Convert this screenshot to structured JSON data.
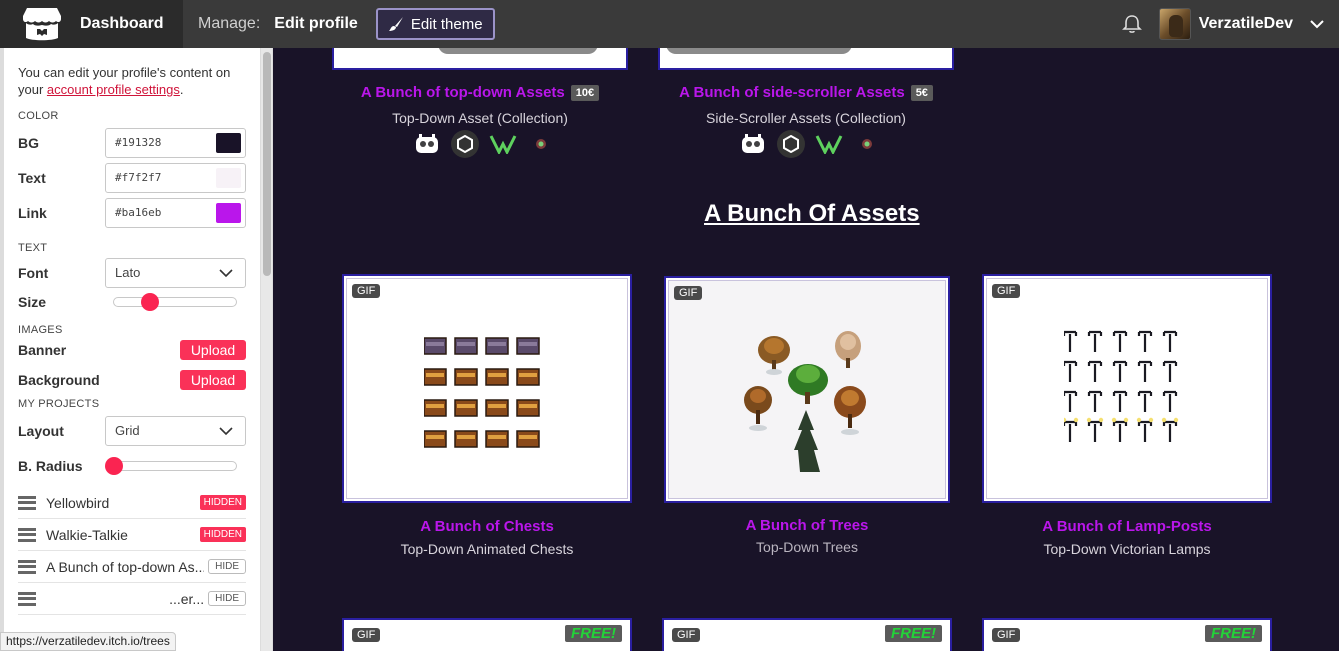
{
  "topbar": {
    "dashboard_label": "Dashboard",
    "manage_label": "Manage:",
    "edit_profile_label": "Edit profile",
    "edit_theme_label": "Edit theme",
    "username": "VerzatileDev"
  },
  "sidebar": {
    "intro_prefix": "You can edit your profile's content on your",
    "intro_link": "account profile settings",
    "intro_suffix": ".",
    "color_section": "COLOR",
    "colors": [
      {
        "label": "BG",
        "value": "#191328",
        "swatch": "#191328"
      },
      {
        "label": "Text",
        "value": "#f7f2f7",
        "swatch": "#f7f2f7"
      },
      {
        "label": "Link",
        "value": "#ba16eb",
        "swatch": "#ba16eb"
      }
    ],
    "text_section": "TEXT",
    "font_label": "Font",
    "font_value": "Lato",
    "size_label": "Size",
    "size_value": 0.25,
    "images_section": "IMAGES",
    "banner_label": "Banner",
    "background_label": "Background",
    "upload_label": "Upload",
    "projects_section": "MY PROJECTS",
    "layout_label": "Layout",
    "layout_value": "Grid",
    "radius_label": "B. Radius",
    "radius_value": 0.0,
    "projects": [
      {
        "name": "Yellowbird",
        "tag": "HIDDEN"
      },
      {
        "name": "Walkie-Talkie",
        "tag": "HIDDEN"
      },
      {
        "name": "A Bunch of top-down As...",
        "tag": "HIDE"
      },
      {
        "name": "...er...",
        "tag": "HIDE"
      }
    ],
    "status_url": "https://verzatiledev.itch.io/trees"
  },
  "main": {
    "top_projects": [
      {
        "title": "A Bunch of top-down Assets",
        "price": "10€",
        "subtitle": "Top-Down Asset (Collection)"
      },
      {
        "title": "A Bunch of side-scroller Assets",
        "price": "5€",
        "subtitle": "Side-Scroller Assets (Collection)"
      }
    ],
    "section_heading": "A Bunch Of Assets",
    "gif_tag": "GIF",
    "free_tag": "FREE!",
    "projects": [
      {
        "title": "A Bunch of Chests",
        "subtitle": "Top-Down Animated Chests"
      },
      {
        "title": "A Bunch of Trees",
        "subtitle": "Top-Down Trees"
      },
      {
        "title": "A Bunch of Lamp-Posts",
        "subtitle": "Top-Down Victorian Lamps"
      }
    ]
  },
  "theme": {
    "bg": "#191328",
    "link": "#ba16eb",
    "accent": "#fa3158",
    "card_border": "#2a1fa0"
  }
}
